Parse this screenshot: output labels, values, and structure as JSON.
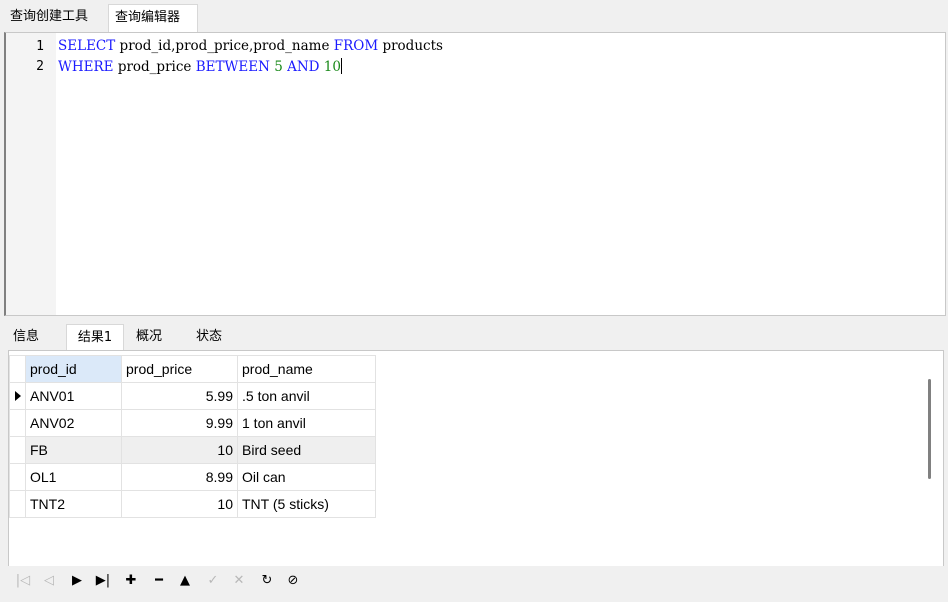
{
  "top_tabs": [
    "查询创建工具",
    "查询编辑器"
  ],
  "editor": {
    "lines": [
      {
        "no": "1",
        "tokens": [
          [
            "kw",
            "SELECT"
          ],
          [
            "txt",
            " prod_id,prod_price,prod_name "
          ],
          [
            "kw",
            "FROM"
          ],
          [
            "txt",
            " products"
          ]
        ]
      },
      {
        "no": "2",
        "tokens": [
          [
            "kw",
            "WHERE"
          ],
          [
            "txt",
            " prod_price "
          ],
          [
            "kw",
            "BETWEEN"
          ],
          [
            "txt",
            " "
          ],
          [
            "num",
            "5"
          ],
          [
            "txt",
            " "
          ],
          [
            "kw",
            "AND"
          ],
          [
            "txt",
            " "
          ],
          [
            "num",
            "10"
          ]
        ]
      }
    ]
  },
  "bottom_tabs": [
    "信息",
    "结果1",
    "概况",
    "状态"
  ],
  "result": {
    "columns": [
      "prod_id",
      "prod_price",
      "prod_name"
    ],
    "rows": [
      [
        "ANV01",
        "5.99",
        ".5 ton anvil"
      ],
      [
        "ANV02",
        "9.99",
        "1 ton anvil"
      ],
      [
        "FB",
        "10",
        "Bird seed"
      ],
      [
        "OL1",
        "8.99",
        "Oil can"
      ],
      [
        "TNT2",
        "10",
        "TNT (5 sticks)"
      ]
    ]
  },
  "nav": {
    "first": "|◁",
    "prev": "◁",
    "next": "▶",
    "last": "▶|",
    "add": "✚",
    "delete": "━",
    "up": "▲",
    "apply": "✓",
    "cancel": "✕",
    "refresh": "↻",
    "stop": "⊘"
  },
  "colors": {
    "keyword": "#1a1aff",
    "number": "#1b8a1b",
    "selected_header": "#dbe9f9"
  }
}
